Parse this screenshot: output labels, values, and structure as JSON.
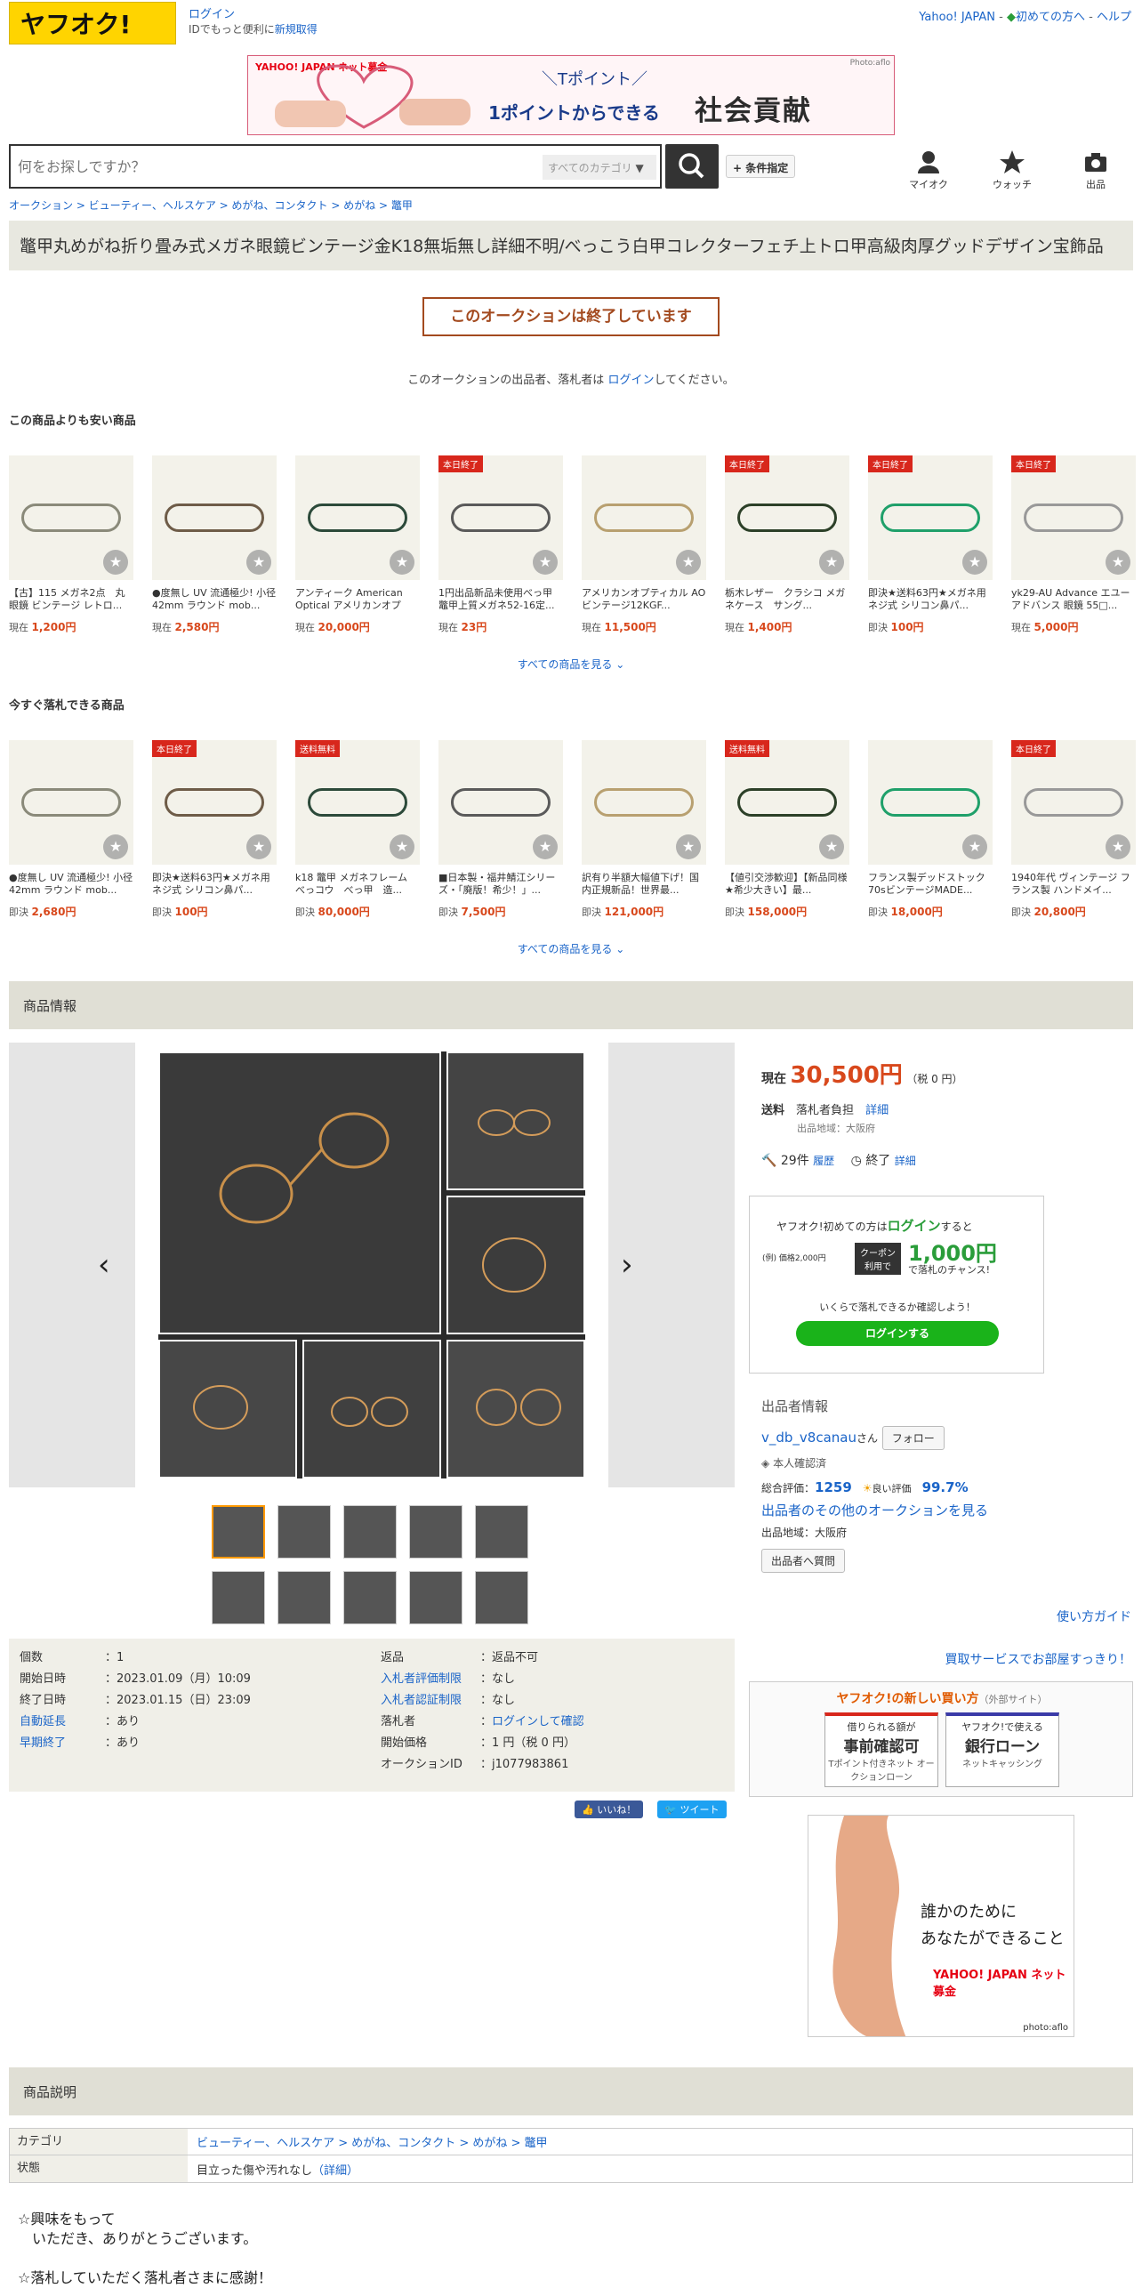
{
  "header": {
    "login": "ログイン",
    "sub_text": "IDでもっと便利に",
    "sub_link": "新規取得",
    "yj": "Yahoo! JAPAN",
    "first": "初めての方へ",
    "help": "ヘルプ"
  },
  "banner": {
    "brand": "YAHOO! JAPAN ネット募金",
    "top": "＼Tポイント／",
    "mid": "1ポイントからできる",
    "big": "社会貢献",
    "credit": "Photo:aflo"
  },
  "search": {
    "placeholder": "何をお探しですか？",
    "category": "すべてのカテゴリ",
    "conditions": "+ 条件指定"
  },
  "nav": [
    "マイオク",
    "ウォッチ",
    "出品"
  ],
  "breadcrumb": "オークション > ビューティー、ヘルスケア > めがね、コンタクト > めがね > 鼈甲",
  "title": "鼈甲丸めがね折り畳み式メガネ眼鏡ビンテージ金K18無垢無し詳細不明/べっこう白甲コレクターフェチ上トロ甲高級肉厚グッドデザイン宝飾品",
  "ended": "このオークションは終了しています",
  "end_note_pre": "このオークションの出品者、落札者は ",
  "end_note_link": "ログイン",
  "end_note_post": "してください。",
  "cheaper": {
    "heading": "この商品よりも安い商品",
    "see_all": "すべての商品を見る",
    "items": [
      {
        "name": "【古】115 メガネ2点　丸眼鏡 ビンテージ レトロ...",
        "label": "現在",
        "price": "1,200円",
        "badge": ""
      },
      {
        "name": "●度無し UV 流通極少! 小径42mm ラウンド mob...",
        "label": "現在",
        "price": "2,580円",
        "badge": ""
      },
      {
        "name": "アンティーク American Optical アメリカンオプテ...",
        "label": "現在",
        "price": "20,000円",
        "badge": ""
      },
      {
        "name": "1円出品新品未使用べっ甲 鼈甲上質メガネ52-16定...",
        "label": "現在",
        "price": "23円",
        "badge": "本日終了"
      },
      {
        "name": "アメリカンオプティカル AO ビンテージ12KGF...",
        "label": "現在",
        "price": "11,500円",
        "badge": ""
      },
      {
        "name": "栃木レザー　クラシコ メガネケース　サング...",
        "label": "現在",
        "price": "1,400円",
        "badge": "本日終了"
      },
      {
        "name": "即決★送料63円★メガネ用ネジ式 シリコン鼻パ...",
        "label": "即決",
        "price": "100円",
        "badge": "本日終了"
      },
      {
        "name": "yk29-AU Advance エユーアドバンス 眼鏡 55□...",
        "label": "現在",
        "price": "5,000円",
        "badge": "本日終了"
      }
    ]
  },
  "buynow": {
    "heading": "今すぐ落札できる商品",
    "see_all": "すべての商品を見る",
    "items": [
      {
        "name": "●度無し UV 流通極少! 小径42mm ラウンド mob...",
        "label": "即決",
        "price": "2,680円",
        "badge": ""
      },
      {
        "name": "即決★送料63円★メガネ用ネジ式 シリコン鼻パ...",
        "label": "即決",
        "price": "100円",
        "badge": "本日終了"
      },
      {
        "name": "k18 鼈甲 メガネフレーム　べっコウ　べっ甲　造...",
        "label": "即決",
        "price": "80,000円",
        "badge": "送料無料"
      },
      {
        "name": "■日本製・福井鯖江シリーズ・「廃版！希少！」...",
        "label": "即決",
        "price": "7,500円",
        "badge": ""
      },
      {
        "name": "訳有り半額大幅値下げ！国内正規新品！世界最...",
        "label": "即決",
        "price": "121,000円",
        "badge": ""
      },
      {
        "name": "【値引交渉歓迎】【新品同様★希少大きい】最...",
        "label": "即決",
        "price": "158,000円",
        "badge": "送料無料"
      },
      {
        "name": "フランス製デッドストック70sビンテージMADE...",
        "label": "即決",
        "price": "18,000円",
        "badge": ""
      },
      {
        "name": "1940年代 ヴィンテージ フランス製 ハンドメイ...",
        "label": "即決",
        "price": "20,800円",
        "badge": "本日終了"
      }
    ]
  },
  "info_heading": "商品情報",
  "price": {
    "label": "現在",
    "value": "30,500円",
    "tax": "（税 0 円）",
    "ship_label": "送料",
    "ship": "落札者負担",
    "detail": "詳細",
    "origin": "出品地域：大阪府",
    "bids": "29件",
    "history": "履歴",
    "end": "終了",
    "end_detail": "詳細"
  },
  "promo": {
    "line1": "ヤフオク!初めての方は",
    "line1_link": "ログイン",
    "line1_post": "すると",
    "ex": "(例) 価格2,000円",
    "coupon": "クーポン 利用で",
    "amount": "1,000円",
    "chance": "で落札のチャンス!",
    "check": "いくらで落札できるか確認しよう！",
    "button": "ログインする"
  },
  "seller": {
    "heading": "出品者情報",
    "name": "v_db_v8canau",
    "san": "さん",
    "follow": "フォロー",
    "verified": "本人確認済",
    "rating_label": "総合評価：",
    "rating": "1259",
    "good_label": "良い評価",
    "good": "99.7%",
    "others": "出品者のその他のオークションを見る",
    "region": "出品地域：大阪府",
    "question": "出品者へ質問"
  },
  "guide": "使い方ガイド",
  "buyservice": "買取サービスでお部屋すっきり！",
  "newbuy": {
    "title": "ヤフオク!の新しい買い方",
    "sub": "（外部サイト）",
    "c1a": "借りられる額が",
    "c1b": "事前確認可",
    "c1c": "Tポイント付きネット オークションローン",
    "c2a": "ヤフオク!で使える",
    "c2b": "銀行ローン",
    "c2c": "ネットキャッシング"
  },
  "ad2": {
    "line1": "誰かのために",
    "line2": "あなたができること",
    "brand": "YAHOO! JAPAN ネット募金",
    "credit": "photo:aflo"
  },
  "spec": {
    "left": [
      [
        "個数",
        "1"
      ],
      [
        "開始日時",
        "2023.01.09（月）10:09"
      ],
      [
        "終了日時",
        "2023.01.15（日）23:09"
      ],
      [
        "自動延長",
        "あり"
      ],
      [
        "早期終了",
        "あり"
      ]
    ],
    "right": [
      [
        "返品",
        "返品不可"
      ],
      [
        "入札者評価制限",
        "なし"
      ],
      [
        "入札者認証制限",
        "なし"
      ],
      [
        "落札者",
        "ログインして確認"
      ],
      [
        "開始価格",
        "1 円（税 0 円）"
      ],
      [
        "オークションID",
        "j1077983861"
      ]
    ]
  },
  "share": {
    "like": "いいね！",
    "tweet": "ツイート"
  },
  "desc_heading": "商品説明",
  "desc_table": {
    "cat_label": "カテゴリ",
    "cat": "ビューティー、ヘルスケア > めがね、コンタクト > めがね > 鼈甲",
    "cond_label": "状態",
    "cond": "目立った傷や汚れなし",
    "cond_detail": "（詳細）"
  },
  "description": [
    "☆興味をもって",
    "　いただき、ありがとうございます。",
    "",
    "☆落札していただく落札者さまに感謝！"
  ]
}
